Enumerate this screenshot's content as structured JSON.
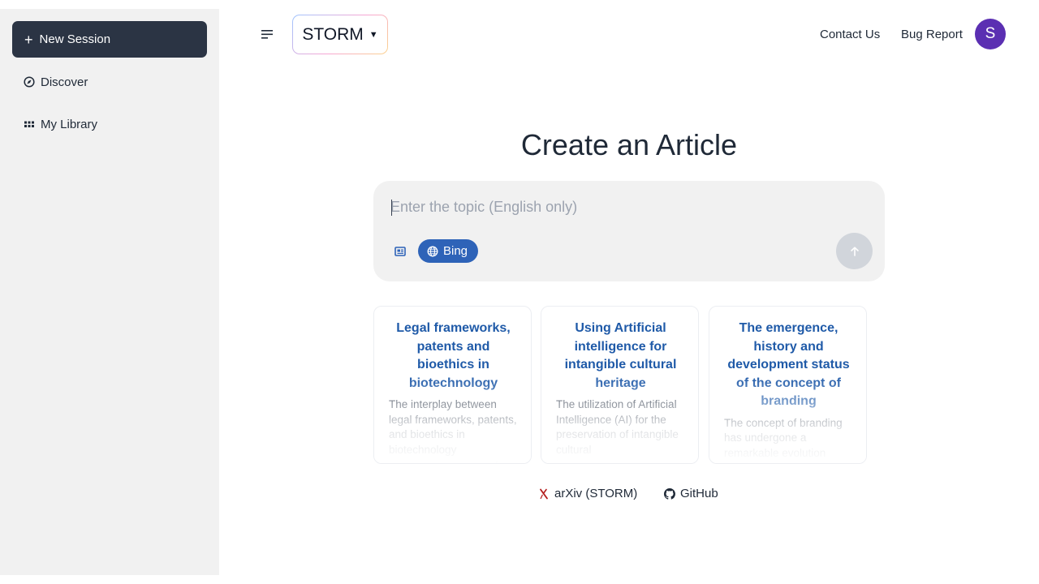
{
  "sidebar": {
    "new_session_label": "New Session",
    "items": [
      {
        "label": "Discover",
        "icon": "compass-icon"
      },
      {
        "label": "My Library",
        "icon": "grid-icon"
      }
    ]
  },
  "header": {
    "brand": "STORM",
    "links": {
      "contact": "Contact Us",
      "bug_report": "Bug Report"
    },
    "avatar_initial": "S"
  },
  "main": {
    "title": "Create an Article",
    "search": {
      "value": "",
      "placeholder": "Enter the topic (English only)",
      "source_label": "Bing"
    },
    "cards": [
      {
        "title": "Legal frameworks, patents and bioethics in biotechnology",
        "excerpt": "The interplay between legal frameworks, patents, and bioethics in biotechnology encompasses a complex and dynamic"
      },
      {
        "title": "Using Artificial intelligence for intangible cultural heritage",
        "excerpt": "The utilization of Artificial Intelligence (AI) for the preservation of intangible cultural"
      },
      {
        "title": "The emergence, history and development status of the concept of branding",
        "excerpt": "The concept of branding has undergone a remarkable evolution"
      }
    ],
    "footer_links": {
      "arxiv": "arXiv (STORM)",
      "github": "GitHub"
    }
  },
  "colors": {
    "sidebar_bg": "#f1f1f1",
    "new_session_bg": "#2b3444",
    "accent": "#2e63b8",
    "card_title": "#1f5aa8",
    "avatar_bg": "#5b2fb2",
    "arxiv_red": "#b31b1b"
  }
}
